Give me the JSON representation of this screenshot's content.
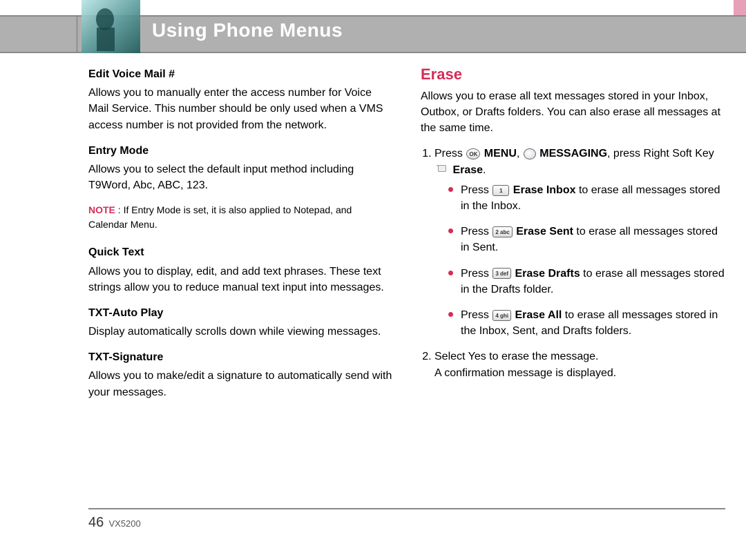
{
  "header": {
    "title": "Using Phone Menus"
  },
  "left": {
    "h1": "Edit Voice Mail #",
    "p1": "Allows you to manually enter the access number for Voice Mail Service. This number should be only used when a VMS access number is not provided from the network.",
    "h2": "Entry Mode",
    "p2": "Allows you to select the default input method including T9Word, Abc, ABC, 123.",
    "noteLabel": "NOTE",
    "noteSep": " :  ",
    "noteText": "If Entry Mode is set, it is also applied to Notepad, and Calendar Menu.",
    "h3": "Quick Text",
    "p3": "Allows you to display, edit, and add text phrases. These text strings allow you to reduce manual text input into messages.",
    "h4": "TXT-Auto Play",
    "p4": "Display automatically scrolls down while viewing messages.",
    "h5": "TXT-Signature",
    "p5": "Allows you to make/edit a signature to automatically send with your messages."
  },
  "right": {
    "section": "Erase",
    "intro": "Allows you to erase all text messages stored in your Inbox, Outbox, or Drafts folders. You can also erase all messages at the same time.",
    "step1": {
      "press": "Press ",
      "okKey": "OK",
      "menu": " MENU",
      "comma": ", ",
      "messaging": " MESSAGING",
      "suffix": ", press Right Soft Key",
      "eraseLabel": " Erase",
      "period": "."
    },
    "keys": {
      "k1": "1",
      "k2": "2 abc",
      "k3": "3 def",
      "k4": "4 ghi"
    },
    "b1": {
      "press": "Press ",
      "bold": " Erase Inbox",
      "rest": " to erase all messages stored in the Inbox."
    },
    "b2": {
      "press": "Press ",
      "bold": " Erase Sent",
      "rest": " to erase all messages stored in Sent."
    },
    "b3": {
      "press": "Press ",
      "bold": " Erase Drafts",
      "rest": " to erase all messages stored in the Drafts folder."
    },
    "b4": {
      "press": "Press ",
      "bold": " Erase All",
      "rest": " to erase all messages stored in the Inbox, Sent, and Drafts folders."
    },
    "step2a": "Select Yes to erase the message.",
    "step2b": "A confirmation message is displayed."
  },
  "footer": {
    "page": "46",
    "model": "VX5200"
  }
}
